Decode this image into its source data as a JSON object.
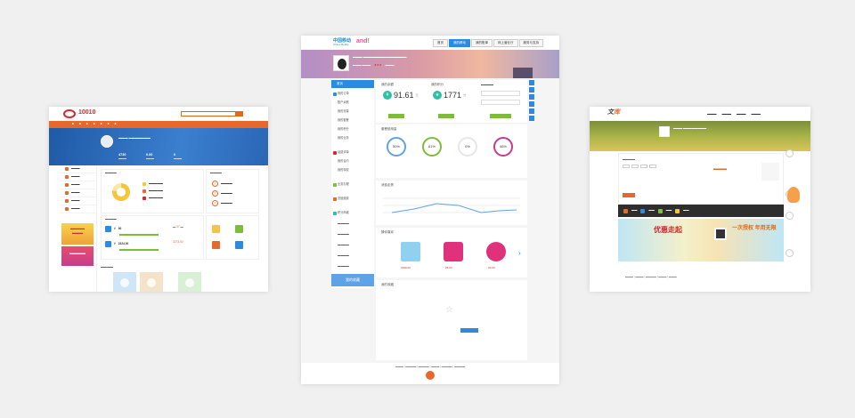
{
  "unicom": {
    "logo_text": "10010",
    "search_placeholder": "",
    "nav": [
      "",
      "",
      "",
      "",
      "",
      "",
      "",
      ""
    ],
    "user_name": "",
    "stats": [
      {
        "value": "4730",
        "label": ""
      },
      {
        "value": "0.00",
        "label": ""
      },
      {
        "value": "0",
        "label": ""
      }
    ],
    "promo1": "",
    "promo2": "",
    "balance_value": "90",
    "package_value": "2324.00",
    "data_value": "3273.00",
    "colors": {
      "accent": "#e8672b",
      "banner": "#2a67b5"
    }
  },
  "mobile": {
    "brand": "中国移动",
    "brand_en": "China Mobile",
    "and_logo_a": "and",
    "and_logo_b": "!",
    "tabs": [
      {
        "label": "首页",
        "active": false
      },
      {
        "label": "我的移动",
        "active": true
      },
      {
        "label": "我的账单",
        "active": false
      },
      {
        "label": "网上营业厅",
        "active": false
      },
      {
        "label": "服务与支持",
        "active": false
      }
    ],
    "stars": "★★★",
    "home_label": "首页",
    "nav_items": [
      "我的订单",
      "账户余额",
      "我的流量",
      "我的套餐",
      "我的积分",
      "我的业务",
      "话费详单",
      "我的合约",
      "我的特权",
      "业务办理",
      "充值缴费",
      "积分商城",
      "我的收藏"
    ],
    "collect_label": "我的收藏",
    "balance": {
      "title": "我的余额",
      "value": "91.61",
      "unit": "元"
    },
    "points": {
      "title": "我的积分",
      "value": "1771",
      "unit": "分"
    },
    "usage_title": "套餐使用量",
    "rings": [
      "50%",
      "81%",
      "0%",
      "46%"
    ],
    "trend_title": "消费走势",
    "rec_title": "猜你喜欢",
    "prices": [
      "¥499.00",
      "¥5.00",
      "¥0.00"
    ],
    "fav_title": "我的收藏",
    "footer_line1": "",
    "footer_line2": "",
    "colors": {
      "accent": "#2b8be0",
      "green": "#7dbd3b",
      "teal": "#2ec1a8"
    }
  },
  "qqlike": {
    "logo_a": "文",
    "logo_b": "库",
    "nav": [
      "",
      "",
      "",
      ""
    ],
    "user_name": "",
    "ad_text": "优惠走起",
    "ad_text2": "一次授权 年用无限",
    "footer": "",
    "colors": {
      "dark": "#2e2e2e",
      "ad_red": "#d8262b"
    }
  }
}
